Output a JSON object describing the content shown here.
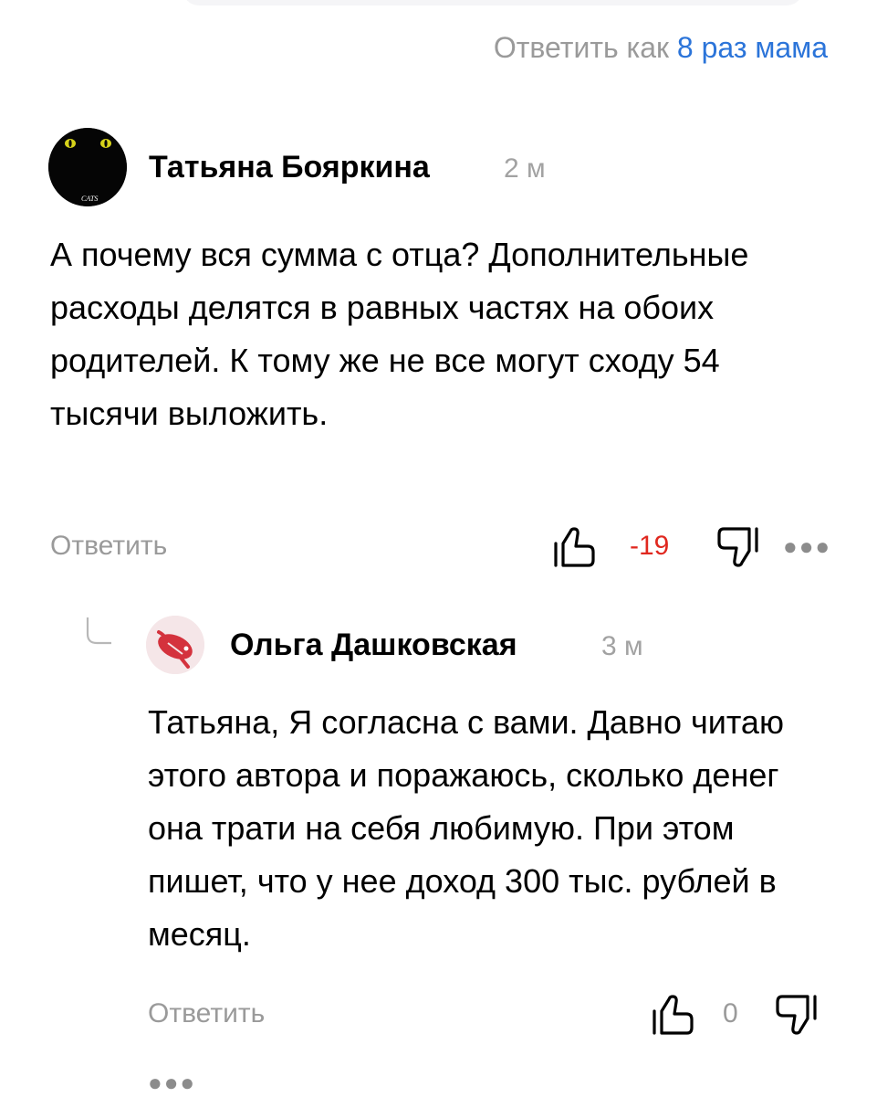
{
  "header": {
    "reply_as_prefix": "Ответить как",
    "reply_as_name": "8 раз мама"
  },
  "comments": [
    {
      "author": "Татьяна Бояркина",
      "time": "2 м",
      "avatar_caption": "CATS",
      "text": "А почему вся сумма с отца? Дополнительные расходы делятся в равных частях на обоих родителей. К тому же не все могут сходу 54 тысячи выложить.",
      "reply_label": "Ответить",
      "score": "-19",
      "score_color": "#e0281f",
      "more_icon": "ellipsis-icon"
    },
    {
      "author": "Ольга Дашковская",
      "time": "3 м",
      "text": "Татьяна, Я согласна с вами. Давно читаю этого автора и поражаюсь, сколько денег она трати на себя любимую. При этом пишет, что у нее доход 300 тыс. рублей в месяц.",
      "reply_label": "Ответить",
      "score": "0",
      "score_color": "#9a9a9a",
      "more_icon": "ellipsis-icon"
    }
  ],
  "colors": {
    "link": "#2b74d9",
    "muted": "#9a9a9a",
    "negative_score": "#e0281f"
  }
}
